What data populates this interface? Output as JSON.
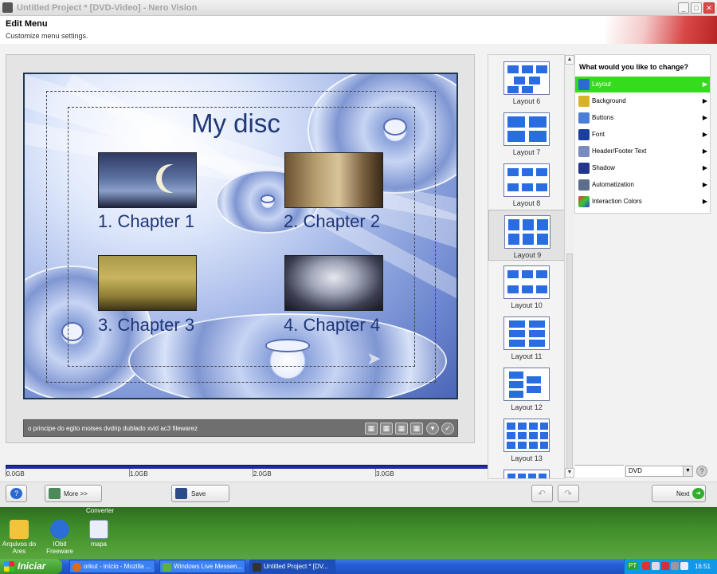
{
  "window": {
    "title": "Untitled Project * [DVD-Video] - Nero Vision"
  },
  "header": {
    "title": "Edit Menu",
    "subtitle": "Customize menu settings."
  },
  "preview": {
    "menu_title": "My disc",
    "chapters": [
      "1. Chapter 1",
      "2. Chapter 2",
      "3. Chapter 3",
      "4. Chapter 4"
    ],
    "status_text": "o principe do egito moises dvdrip dublado xvid ac3 filewarez"
  },
  "capacity": {
    "labels": [
      "0.0GB",
      "1.0GB",
      "2.0GB",
      "3.0GB"
    ]
  },
  "layouts": [
    "Layout 6",
    "Layout 7",
    "Layout 8",
    "Layout 9",
    "Layout 10",
    "Layout 11",
    "Layout 12",
    "Layout 13"
  ],
  "change_panel": {
    "title": "What would you like to change?",
    "items": [
      "Layout",
      "Background",
      "Buttons",
      "Font",
      "Header/Footer Text",
      "Shadow",
      "Automatization",
      "Interaction Colors"
    ],
    "active_index": 0,
    "active_color": "#35dc1e"
  },
  "disc_type": {
    "selected": "DVD"
  },
  "buttons": {
    "more": "More >>",
    "save": "Save",
    "next": "Next"
  },
  "desktop": {
    "icons": [
      "Arquivos do Ares",
      "IObit Freeware",
      "mapa"
    ],
    "partial_label": "Converter"
  },
  "taskbar": {
    "start": "Iniciar",
    "tasks": [
      "orkut - início - Mozilla ...",
      "Windows Live Messen...",
      "Untitled Project * [DV..."
    ],
    "language": "PT",
    "time": "16:51"
  }
}
